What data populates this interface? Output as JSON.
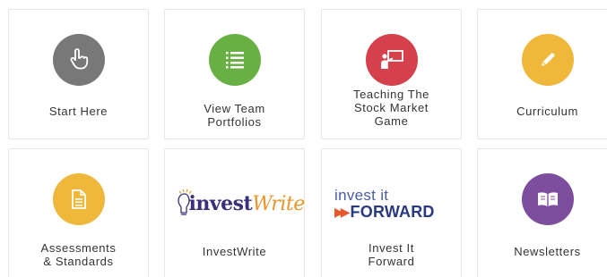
{
  "colors": {
    "start_here": "#787878",
    "view_team_portfolios": "#69b044",
    "teaching_the_stock_market_game": "#d4414d",
    "curriculum": "#f0b83a",
    "assessments_standards": "#f0b83a",
    "newsletters": "#7e4e9e",
    "tile_border": "#e6e6e6",
    "label_text": "#333333"
  },
  "tiles": [
    {
      "id": "start-here",
      "icon": "pointing-hand-icon",
      "label_lines": [
        "Start Here"
      ]
    },
    {
      "id": "view-team-portfolios",
      "icon": "list-icon",
      "label_lines": [
        "View Team",
        "Portfolios"
      ]
    },
    {
      "id": "teaching-the-stock-market-game",
      "icon": "presenter-board-icon",
      "label_lines": [
        "Teaching The",
        "Stock Market",
        "Game"
      ]
    },
    {
      "id": "curriculum",
      "icon": "pencil-icon",
      "label_lines": [
        "Curriculum"
      ]
    },
    {
      "id": "assessments-standards",
      "icon": "document-icon",
      "label_lines": [
        "Assessments",
        "& Standards"
      ]
    },
    {
      "id": "investwrite",
      "icon": "investwrite-logo",
      "logo_text_main": "invest",
      "logo_text_script": "Write",
      "label_lines": [
        "InvestWrite"
      ]
    },
    {
      "id": "invest-it-forward",
      "icon": "invest-it-forward-logo",
      "logo_text_top": "invest it",
      "logo_text_arrows": "▶▶",
      "logo_text_bottom": "FORWARD",
      "label_lines": [
        "Invest It",
        "Forward"
      ]
    },
    {
      "id": "newsletters",
      "icon": "open-book-icon",
      "label_lines": [
        "Newsletters"
      ]
    }
  ]
}
